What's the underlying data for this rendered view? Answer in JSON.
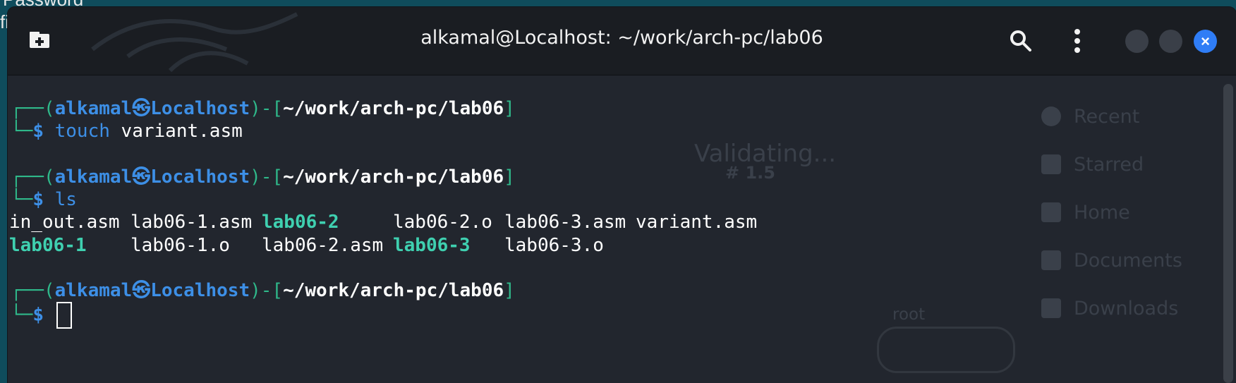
{
  "background": {
    "password_text": "Password",
    "side_text": "fi"
  },
  "window": {
    "title": "alkamal@Localhost: ~/work/arch-pc/lab06",
    "new_tab_icon": "new-tab-icon",
    "search_icon": "search-icon",
    "menu_icon": "kebab-menu-icon",
    "close_glyph": "×"
  },
  "terminal": {
    "prompt_user": "alkamal",
    "prompt_host": "Localhost",
    "prompt_path": "~/work/arch-pc/lab06",
    "prompt_symbol": "$",
    "commands": [
      {
        "cmd": "touch",
        "args": " variant.asm"
      },
      {
        "cmd": "ls",
        "args": ""
      }
    ],
    "ls_output": {
      "row1": [
        {
          "name": "in_out.asm",
          "exec": false
        },
        {
          "name": "lab06-1.asm",
          "exec": false
        },
        {
          "name": "lab06-2",
          "exec": true
        },
        {
          "name": "lab06-2.o",
          "exec": false
        },
        {
          "name": "lab06-3.asm",
          "exec": false
        },
        {
          "name": "variant.asm",
          "exec": false
        }
      ],
      "row2": [
        {
          "name": "lab06-1",
          "exec": true
        },
        {
          "name": "lab06-1.o",
          "exec": false
        },
        {
          "name": "lab06-2.asm",
          "exec": false
        },
        {
          "name": "lab06-3",
          "exec": true
        },
        {
          "name": "lab06-3.o",
          "exec": false
        }
      ]
    }
  },
  "ghost_ui": {
    "validating": "Validating...",
    "version": "# 1.5",
    "root": "root",
    "places": [
      "Recent",
      "Starred",
      "Home",
      "Documents",
      "Downloads"
    ]
  },
  "colors": {
    "prompt_frame": "#2fb88a",
    "prompt_user_host": "#3d8fe6",
    "executable": "#3fd0b0",
    "close_button": "#2f7df6"
  }
}
